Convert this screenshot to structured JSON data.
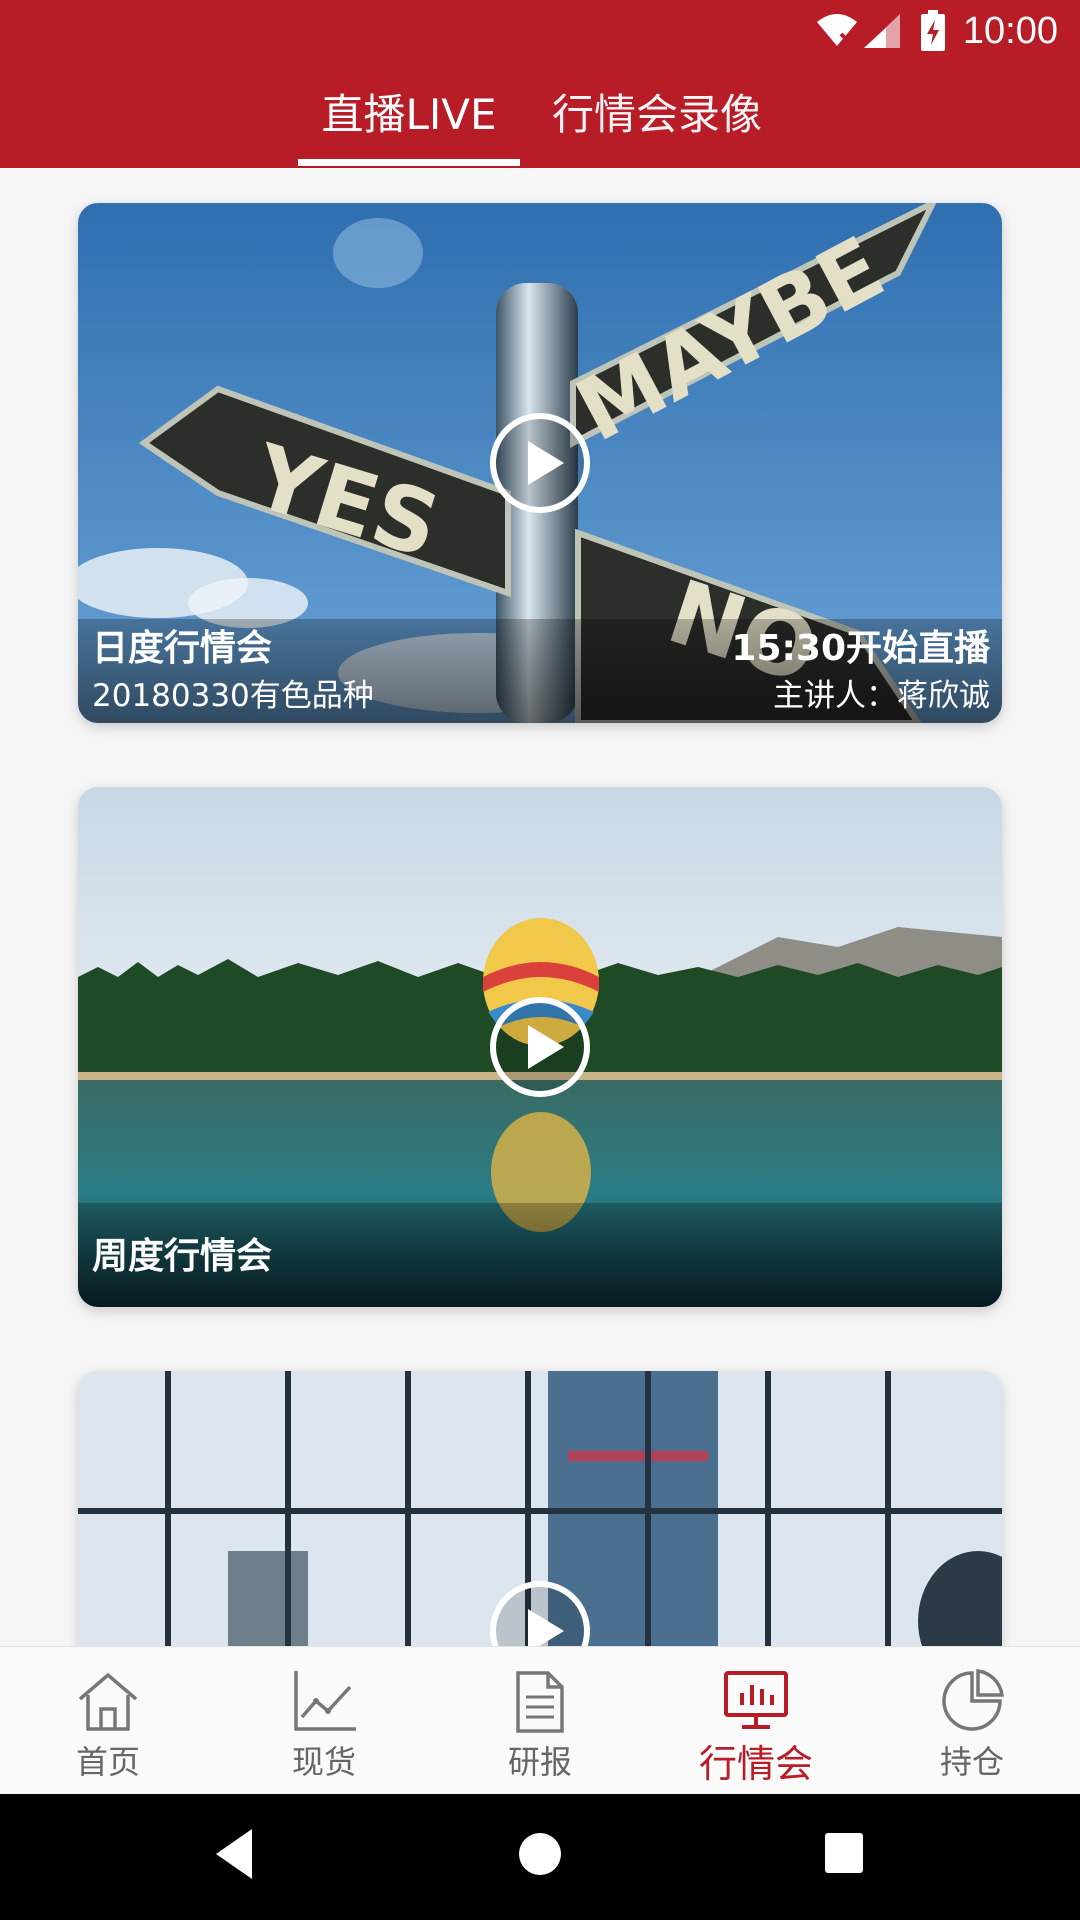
{
  "status_bar": {
    "time": "10:00"
  },
  "tabs": {
    "live": "直播LIVE",
    "replay": "行情会录像"
  },
  "cards": [
    {
      "title": "日度行情会",
      "subtitle": "20180330有色品种",
      "right_title": "15:30开始直播",
      "right_subtitle": "主讲人：蒋欣诚"
    },
    {
      "title": "周度行情会"
    },
    {
      "title": ""
    }
  ],
  "bottom_nav": {
    "items": [
      {
        "label": "首页",
        "icon": "home-icon"
      },
      {
        "label": "现货",
        "icon": "line-chart-icon"
      },
      {
        "label": "研报",
        "icon": "document-icon"
      },
      {
        "label": "行情会",
        "icon": "presentation-icon"
      },
      {
        "label": "持仓",
        "icon": "pie-chart-icon"
      }
    ],
    "active_index": 3
  },
  "colors": {
    "brand_red": "#b71c27",
    "inactive_gray": "#666666"
  }
}
